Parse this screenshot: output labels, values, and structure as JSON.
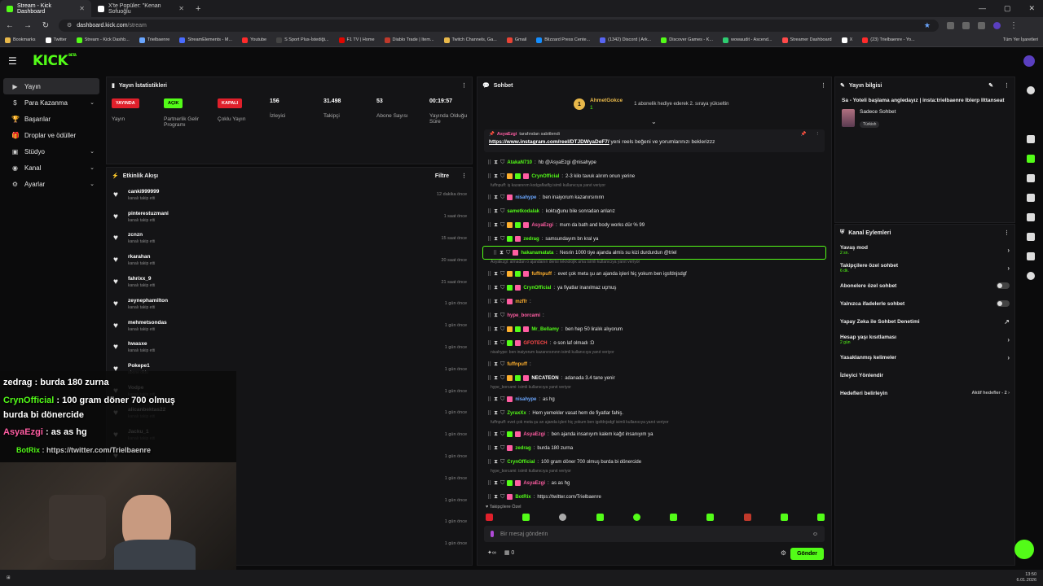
{
  "browser": {
    "tabs": [
      {
        "title": "Stream - Kick Dashboard",
        "active": true,
        "icon_color": "#53fc18"
      },
      {
        "title": "X'te Popüler: \"Kenan Sofuoğlu",
        "active": false,
        "icon_color": "#ffffff"
      }
    ],
    "url_domain": "dashboard.kick.com",
    "url_path": "/stream",
    "bookmarks": [
      {
        "label": "Bookmarks",
        "color": "#e8b84a"
      },
      {
        "label": "Twitter",
        "color": "#ffffff"
      },
      {
        "label": "Stream - Kick Dashb...",
        "color": "#53fc18"
      },
      {
        "label": "Trielbaenre",
        "color": "#6aa6ff"
      },
      {
        "label": "StreamElements - M...",
        "color": "#4a6cff"
      },
      {
        "label": "Youtube",
        "color": "#ff2b2b"
      },
      {
        "label": "S Sport Plus-İstediği...",
        "color": "#444444"
      },
      {
        "label": "F1 TV | Home",
        "color": "#e10600"
      },
      {
        "label": "Diablo Trade | Item...",
        "color": "#c0392b"
      },
      {
        "label": "Twitch Channels, Ga...",
        "color": "#e8b84a"
      },
      {
        "label": "Gmail",
        "color": "#ea4335"
      },
      {
        "label": "Blizzard Press Cente...",
        "color": "#148eff"
      },
      {
        "label": "(1342) Discord | Ark...",
        "color": "#5865f2"
      },
      {
        "label": "Discover Games - K...",
        "color": "#53fc18"
      },
      {
        "label": "wowaudit - Ascend...",
        "color": "#2ecc71"
      },
      {
        "label": "Streamer Dashboard",
        "color": "#ff4a4a"
      },
      {
        "label": "X",
        "color": "#ffffff"
      },
      {
        "label": "(23) Trielbaenre - Yo...",
        "color": "#ff2b2b"
      }
    ],
    "all_bookmarks": "Tüm Yer İşaretleri"
  },
  "nav": {
    "items": [
      {
        "label": "Yayın",
        "chevron": ""
      },
      {
        "label": "Para Kazanma",
        "chevron": "⌄"
      },
      {
        "label": "Başarılar",
        "chevron": ""
      },
      {
        "label": "Droplar ve ödüller",
        "chevron": ""
      },
      {
        "label": "Stüdyo",
        "chevron": "⌄"
      },
      {
        "label": "Kanal",
        "chevron": "⌄"
      },
      {
        "label": "Ayarlar",
        "chevron": "⌄"
      }
    ]
  },
  "stats": {
    "title": "Yayın İstatistikleri",
    "badges": [
      {
        "badge": "YAYINDA",
        "label": "Yayın",
        "color": "#e0202b"
      },
      {
        "badge": "AÇIK",
        "label": "Partnerlik Gelir Programı",
        "color": "#53fc18"
      },
      {
        "badge": "KAPALI",
        "label": "Çoklu Yayın",
        "color": "#e0202b"
      }
    ],
    "values": [
      {
        "value": "156",
        "label": "İzleyici"
      },
      {
        "value": "31.498",
        "label": "Takipçi"
      },
      {
        "value": "53",
        "label": "Abone Sayısı"
      },
      {
        "value": "00:19:57",
        "label": "Yayında Olduğu Süre"
      }
    ]
  },
  "activity": {
    "title": "Etkinlik Akışı",
    "filter": "Filtre",
    "items": [
      {
        "user": "canki999999",
        "desc": "kanalı takip etti",
        "time": "12 dakika önce"
      },
      {
        "user": "pinterestuzmani",
        "desc": "kanalı takip etti",
        "time": "1 saat önce"
      },
      {
        "user": "zcnzn",
        "desc": "kanalı takip etti",
        "time": "15 saat önce"
      },
      {
        "user": "rkarahan",
        "desc": "kanalı takip etti",
        "time": "20 saat önce"
      },
      {
        "user": "fahrixx_9",
        "desc": "kanalı takip etti",
        "time": "21 saat önce"
      },
      {
        "user": "zeynephamilton",
        "desc": "kanalı takip etti",
        "time": "1 gün önce"
      },
      {
        "user": "mehmetsondas",
        "desc": "kanalı takip etti",
        "time": "1 gün önce"
      },
      {
        "user": "hwasxe",
        "desc": "kanalı takip etti",
        "time": "1 gün önce"
      },
      {
        "user": "Pokepe1",
        "desc": "abone oldu",
        "time": "1 gün önce"
      },
      {
        "user": "Vodpe",
        "desc": "kanalı takip etti",
        "time": "1 gün önce"
      },
      {
        "user": "alicanbektas22",
        "desc": "kanalı takip etti",
        "time": "1 gün önce"
      },
      {
        "user": "Jacku_1",
        "desc": "kanalı takip etti",
        "time": "1 gün önce"
      },
      {
        "user": "",
        "desc": "",
        "time": "1 gün önce"
      },
      {
        "user": "",
        "desc": "süresi - 18 ay!",
        "time": "1 gün önce"
      },
      {
        "user": "",
        "desc": "",
        "time": "1 gün önce"
      },
      {
        "user": "",
        "desc": "",
        "time": "1 gün önce"
      },
      {
        "user": "",
        "desc": "",
        "time": "1 gün önce"
      }
    ]
  },
  "chat": {
    "title": "Sohbet",
    "top_gifter": "AhmetGokce",
    "top_gifter_count": "1",
    "top_gifter_note": "1 abonelik hediye ederek 2. sıraya yükseltin",
    "pinned_by": "AsyaEzgi",
    "pinned_by_suffix": "tarafından sabitlendi",
    "pinned_link": "https://www.instagram.com/reel/DTJDWyaDeF7/",
    "pinned_text": "yeni reels beğeni ve yorumlarınızı bekleriz​zz",
    "messages": [
      {
        "kind": "msg",
        "user": "AtakaN710",
        "color": "#53fc18",
        "text": "hb @AsyaEzgi @nisahype"
      },
      {
        "kind": "msg",
        "user": "CrynOfficial",
        "color": "#53fc18",
        "text": "2-3 kilo tavuk alırım onun yerine"
      },
      {
        "kind": "reply",
        "text": "fuffnpuff: iş kazanırım kodgafladfg isimli kullanıcıya yanıt veriyor"
      },
      {
        "kind": "msg",
        "user": "nisahype",
        "color": "#6aa6ff",
        "text": "ben inaiyorum kazanırsınınn"
      },
      {
        "kind": "msg",
        "user": "sametkodalak",
        "color": "#53fc18",
        "text": "koktuğunu bile sonradan anlarız"
      },
      {
        "kind": "msg",
        "user": "AsyaEzgi",
        "color": "#ff5da2",
        "text": "mum da bath and body works dür % 99"
      },
      {
        "kind": "msg",
        "user": "zedrag",
        "color": "#53fc18",
        "text": "samsundayım bn kral ya"
      },
      {
        "kind": "hl",
        "user": "hakanamatata",
        "color": "#53fc18",
        "text": "Nesrin 1000 tiye ajanda almis su kizi durdurdun @triel"
      },
      {
        "kind": "reply",
        "text": "AsyaEzgi: almadan o ajandanın derisi teknolojik ama isimli kullanıcıya yanıt veriyor"
      },
      {
        "kind": "msg",
        "user": "fuffnpuff",
        "color": "#ffb02e",
        "text": "evet çok meta şu an ajanda işleri hiç yokum ben igsfdnjsdgf"
      },
      {
        "kind": "msg",
        "user": "CrynOfficial",
        "color": "#53fc18",
        "text": "ya fiyatlar inanılmaz uçmuş"
      },
      {
        "kind": "msg",
        "user": "mzffr",
        "color": "#ffb02e",
        "text": ""
      },
      {
        "kind": "msg",
        "user": "hype_borcami",
        "color": "#ff5da2",
        "text": ""
      },
      {
        "kind": "msg",
        "user": "Mr_Bellamy",
        "color": "#53fc18",
        "text": "ben hep 50 liralık alıyorum"
      },
      {
        "kind": "msg",
        "user": "GFOTECH",
        "color": "#ff4a4a",
        "text": "o son laf olmadı :D"
      },
      {
        "kind": "reply",
        "text": "nisahype: ben inaiyorum kazanırsınınn isimli kullanıcıya yanıt veriyor"
      },
      {
        "kind": "msg",
        "user": "fuffnpuff",
        "color": "#ffb02e",
        "text": ""
      },
      {
        "kind": "msg",
        "user": "NECATEON",
        "color": "#ffffff",
        "text": "adanada 3.4 tane yenir"
      },
      {
        "kind": "reply",
        "text": "hype_borcami: isimli kullanıcıya yanıt veriyor"
      },
      {
        "kind": "msg",
        "user": "nisahype",
        "color": "#6aa6ff",
        "text": "as hg"
      },
      {
        "kind": "msg",
        "user": "ZyraxXx",
        "color": "#53fc18",
        "text": "Hem yemekler vasat hem de fiyatlar fahiş."
      },
      {
        "kind": "reply",
        "text": "fuffnpuff: evet çok meta şu an ajanda işleri hiç yokum ben igsfdnjsdgf isimli kullanıcıya yanıt veriyor"
      },
      {
        "kind": "msg",
        "user": "AsyaEzgi",
        "color": "#ff5da2",
        "text": "ben ajanda insanıyım kalem kağıt insanıyım ya"
      },
      {
        "kind": "msg",
        "user": "zedrag",
        "color": "#53fc18",
        "text": "burda 180 zurna"
      },
      {
        "kind": "msg",
        "user": "CrynOfficial",
        "color": "#53fc18",
        "text": "100 gram döner 700 olmuş burda bi dönercide"
      },
      {
        "kind": "reply",
        "text": "hype_borcami: isimli kullanıcıya yanıt veriyor"
      },
      {
        "kind": "msg",
        "user": "AsyaEzgi",
        "color": "#ff5da2",
        "text": "as as hg"
      },
      {
        "kind": "msg",
        "user": "BotRix",
        "color": "#53fc18",
        "text": "https://twitter.com/Trielbaenre"
      }
    ],
    "followers_only": "Takipçilere Özel",
    "input_placeholder": "Bir mesaj gönderin",
    "points": "0",
    "send": "Gönder"
  },
  "stream_info": {
    "title": "Yayın bilgisi",
    "stream_title": "Sa - Yoteli başlama angledayız | insta:trielbaenre Iblerp Ilttanseat",
    "category": "Sadece Sohbet",
    "language": "Türkish"
  },
  "channel_actions": {
    "title": "Kanal Eylemleri",
    "rows": [
      {
        "label": "Yavaş mod",
        "sub": "2 sn.",
        "control": "›"
      },
      {
        "label": "Takipçilere özel sohbet",
        "sub": "6 dk.",
        "control": "›"
      },
      {
        "label": "Abonelere özel sohbet",
        "sub": "",
        "control": "toggle"
      },
      {
        "label": "Yalnızca ifadelerle sohbet",
        "sub": "",
        "control": "toggle"
      },
      {
        "label": "Yapay Zeka ile Sohbet Denetimi",
        "sub": "",
        "control": "↗"
      },
      {
        "label": "Hesap yaşı kısıtlaması",
        "sub": "2 gün",
        "control": "›"
      },
      {
        "label": "Yasaklanmış kelimeler",
        "sub": "",
        "control": "›"
      },
      {
        "label": "İzleyici Yönlendir",
        "sub": "",
        "control": ""
      },
      {
        "label": "Hedefleri belirleyin",
        "sub": "",
        "control": "Aktif hedefler - 2 ›"
      }
    ]
  },
  "overlay": {
    "lines": [
      {
        "user": "zedrag",
        "text": " : burda 180 zurna",
        "color": "#ffffff"
      },
      {
        "user": "CrynOfficial",
        "text": " : 100 gram döner 700 olmuş",
        "color": "#53fc18"
      },
      {
        "user": "",
        "text": "burda bi dönercide",
        "color": "#ffffff"
      },
      {
        "user": "AsyaEzgi",
        "text": " : as as hg",
        "color": "#ff5da2"
      },
      {
        "user": "BotRix",
        "text": " : https://twitter.com/Trielbaenre",
        "color": "#53fc18"
      }
    ]
  },
  "taskbar": {
    "time": "13:50",
    "date": "6.01.2026"
  },
  "colors": {
    "accent": "#53fc18",
    "live": "#e0202b"
  }
}
